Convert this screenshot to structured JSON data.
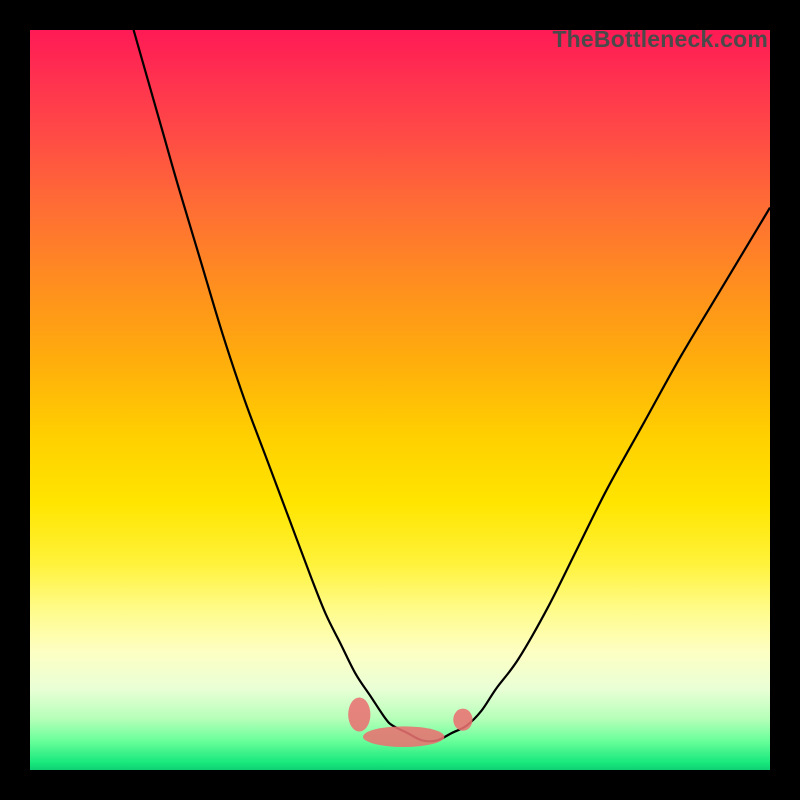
{
  "watermark_text": "TheBottleneck.com",
  "chart_data": {
    "type": "line",
    "title": "",
    "xlabel": "",
    "ylabel": "",
    "xlim": [
      0,
      100
    ],
    "ylim": [
      0,
      100
    ],
    "grid": false,
    "series": [
      {
        "name": "main-curve",
        "x": [
          14,
          16,
          18,
          20,
          23,
          26,
          29,
          32,
          35,
          38,
          40,
          42,
          44,
          46,
          48,
          49,
          51,
          53,
          55,
          57,
          59,
          61,
          63,
          66,
          70,
          74,
          78,
          83,
          88,
          94,
          100
        ],
        "y": [
          100,
          93,
          86,
          79,
          69,
          59,
          50,
          42,
          34,
          26,
          21,
          17,
          13,
          10,
          7,
          6,
          5,
          4,
          4,
          5,
          6,
          8,
          11,
          15,
          22,
          30,
          38,
          47,
          56,
          66,
          76
        ]
      }
    ],
    "markers": [
      {
        "name": "plateau-blob-main",
        "cx": 50.5,
        "cy": 4.5,
        "rx": 5.5,
        "ry": 1.4
      },
      {
        "name": "plateau-blob-left",
        "cx": 44.5,
        "cy": 7.5,
        "rx": 1.5,
        "ry": 2.3
      },
      {
        "name": "plateau-blob-right",
        "cx": 58.5,
        "cy": 6.8,
        "rx": 1.3,
        "ry": 1.5
      }
    ],
    "background_gradient_top": "#ff1a55",
    "background_gradient_bottom": "#0fd073"
  }
}
